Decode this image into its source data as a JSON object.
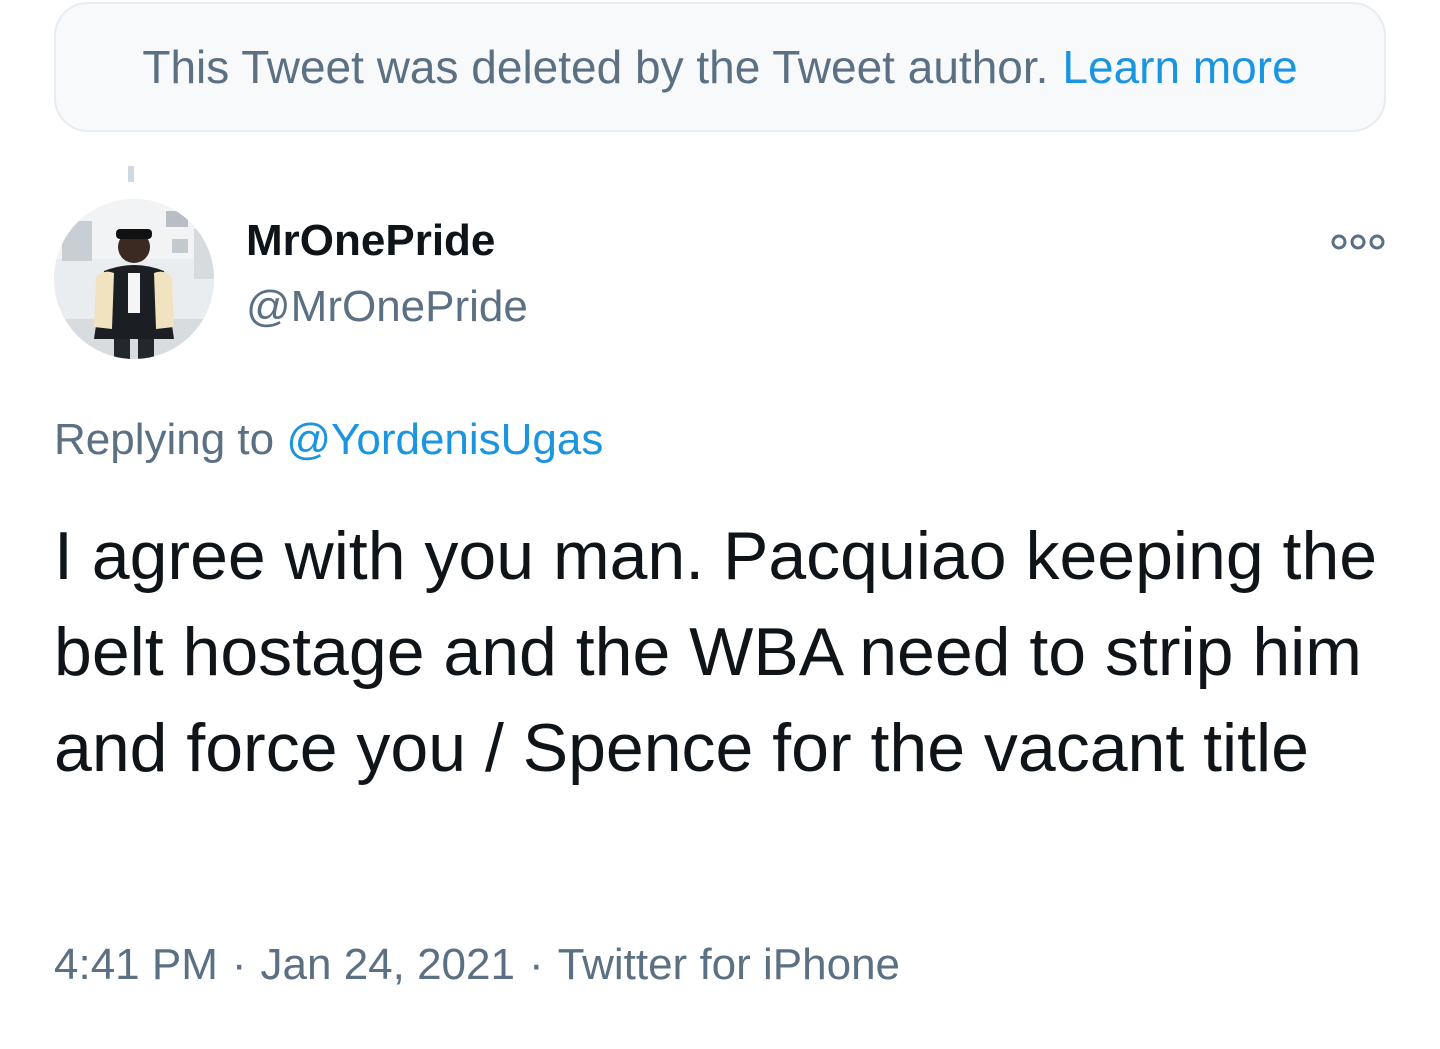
{
  "deleted_notice": {
    "text": "This Tweet was deleted by the Tweet author.",
    "link": "Learn more"
  },
  "tweet": {
    "display_name": "MrOnePride",
    "handle": "@MrOnePride",
    "reply_prefix": "Replying to",
    "reply_to": "@YordenisUgas",
    "text": "I agree with you man. Pacquiao keeping the belt hostage and the WBA need to strip him and force you / Spence for the vacant title",
    "time": "4:41 PM",
    "separator": "·",
    "date": "Jan 24, 2021",
    "source": "Twitter for iPhone"
  },
  "icons": {
    "more": "more-options-icon",
    "avatar": "user-avatar"
  },
  "colors": {
    "link": "#1b95e0",
    "secondary_text": "#5b7083",
    "primary_text": "#0f1419",
    "banner_bg": "#f7f9fa",
    "banner_border": "#e6ecf0"
  }
}
